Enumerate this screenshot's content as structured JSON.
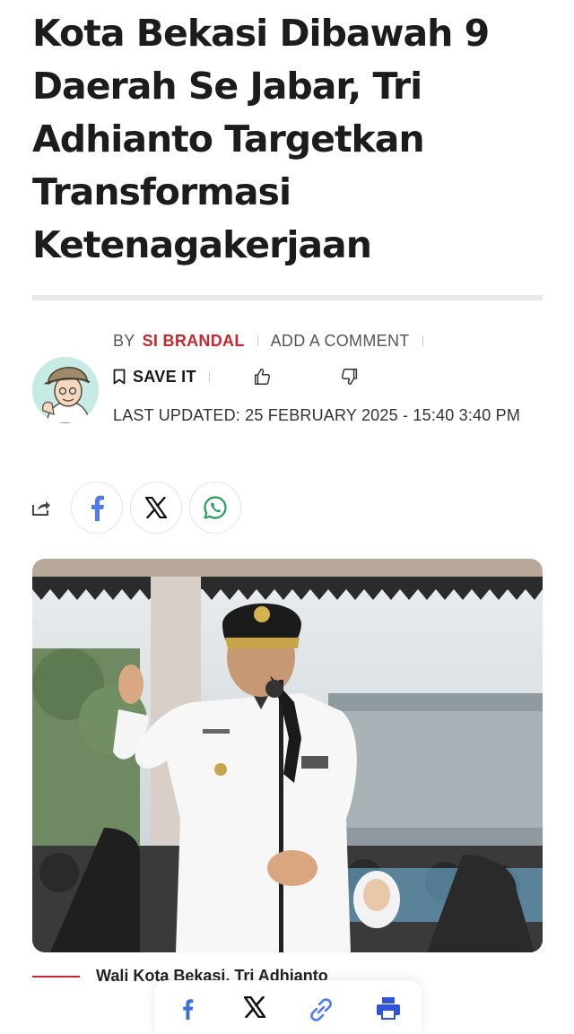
{
  "article": {
    "title": "Kota Bekasi Dibawah 9 Daerah Se Jabar, Tri Adhianto Targetkan Transformasi Ketenagakerjaan"
  },
  "byline": {
    "by_label": "BY",
    "author": "SI BRANDAL",
    "comment_label": "ADD A COMMENT"
  },
  "actions": {
    "save_label": "SAVE IT",
    "like_icon": "thumbs-up-icon",
    "dislike_icon": "thumbs-down-icon"
  },
  "updated": {
    "text": "LAST UPDATED: 25 FEBRUARY 2025 - 15:40 3:40 PM"
  },
  "share": {
    "icon": "share-icon",
    "buttons": [
      "facebook-icon",
      "x-icon",
      "whatsapp-icon"
    ]
  },
  "image": {
    "caption": "Wali Kota Bekasi, Tri Adhianto"
  },
  "share_bar": {
    "icons": [
      "facebook-icon",
      "x-icon",
      "link-icon",
      "print-icon"
    ]
  },
  "colors": {
    "accent": "#c8272d",
    "facebook": "#3b6fe0",
    "whatsapp": "#25a05a",
    "print": "#2d55d6"
  }
}
